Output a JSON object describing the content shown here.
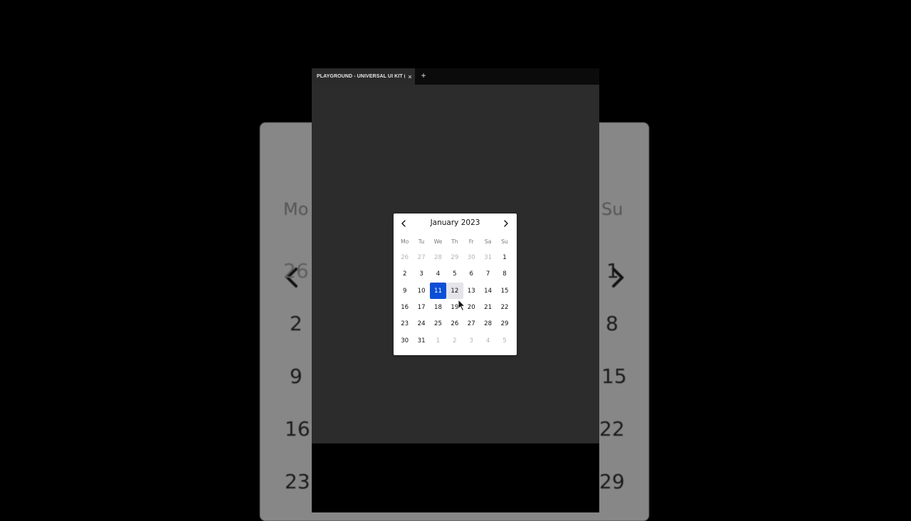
{
  "backdrop": {
    "weekday_left": "Mo",
    "weekday_right": "Su",
    "left_column": [
      "26",
      "2",
      "9",
      "16",
      "23"
    ],
    "right_column": [
      "1",
      "8",
      "15",
      "22",
      "29"
    ]
  },
  "tabbar": {
    "tab_label": "PLAYGROUND - UNIVERSAL UI KIT (W",
    "close_glyph": "×",
    "add_glyph": "+"
  },
  "calendar": {
    "title": "January 2023",
    "weekdays": [
      "Mo",
      "Tu",
      "We",
      "Th",
      "Fr",
      "Sa",
      "Su"
    ],
    "selected_day": "11",
    "hovered_day": "12",
    "weeks": [
      [
        {
          "d": "26",
          "m": true
        },
        {
          "d": "27",
          "m": true
        },
        {
          "d": "28",
          "m": true
        },
        {
          "d": "29",
          "m": true
        },
        {
          "d": "30",
          "m": true
        },
        {
          "d": "31",
          "m": true
        },
        {
          "d": "1"
        }
      ],
      [
        {
          "d": "2"
        },
        {
          "d": "3"
        },
        {
          "d": "4"
        },
        {
          "d": "5"
        },
        {
          "d": "6"
        },
        {
          "d": "7"
        },
        {
          "d": "8"
        }
      ],
      [
        {
          "d": "9"
        },
        {
          "d": "10"
        },
        {
          "d": "11"
        },
        {
          "d": "12"
        },
        {
          "d": "13"
        },
        {
          "d": "14"
        },
        {
          "d": "15"
        }
      ],
      [
        {
          "d": "16"
        },
        {
          "d": "17"
        },
        {
          "d": "18"
        },
        {
          "d": "19"
        },
        {
          "d": "20"
        },
        {
          "d": "21"
        },
        {
          "d": "22"
        }
      ],
      [
        {
          "d": "23"
        },
        {
          "d": "24"
        },
        {
          "d": "25"
        },
        {
          "d": "26"
        },
        {
          "d": "27"
        },
        {
          "d": "28"
        },
        {
          "d": "29"
        }
      ],
      [
        {
          "d": "30"
        },
        {
          "d": "31"
        },
        {
          "d": "1",
          "m": true
        },
        {
          "d": "2",
          "m": true
        },
        {
          "d": "3",
          "m": true
        },
        {
          "d": "4",
          "m": true
        },
        {
          "d": "5",
          "m": true
        }
      ]
    ],
    "icons": {
      "prev": "chevron-left-icon",
      "next": "chevron-right-icon"
    },
    "accent_color": "#0b4fd6"
  }
}
